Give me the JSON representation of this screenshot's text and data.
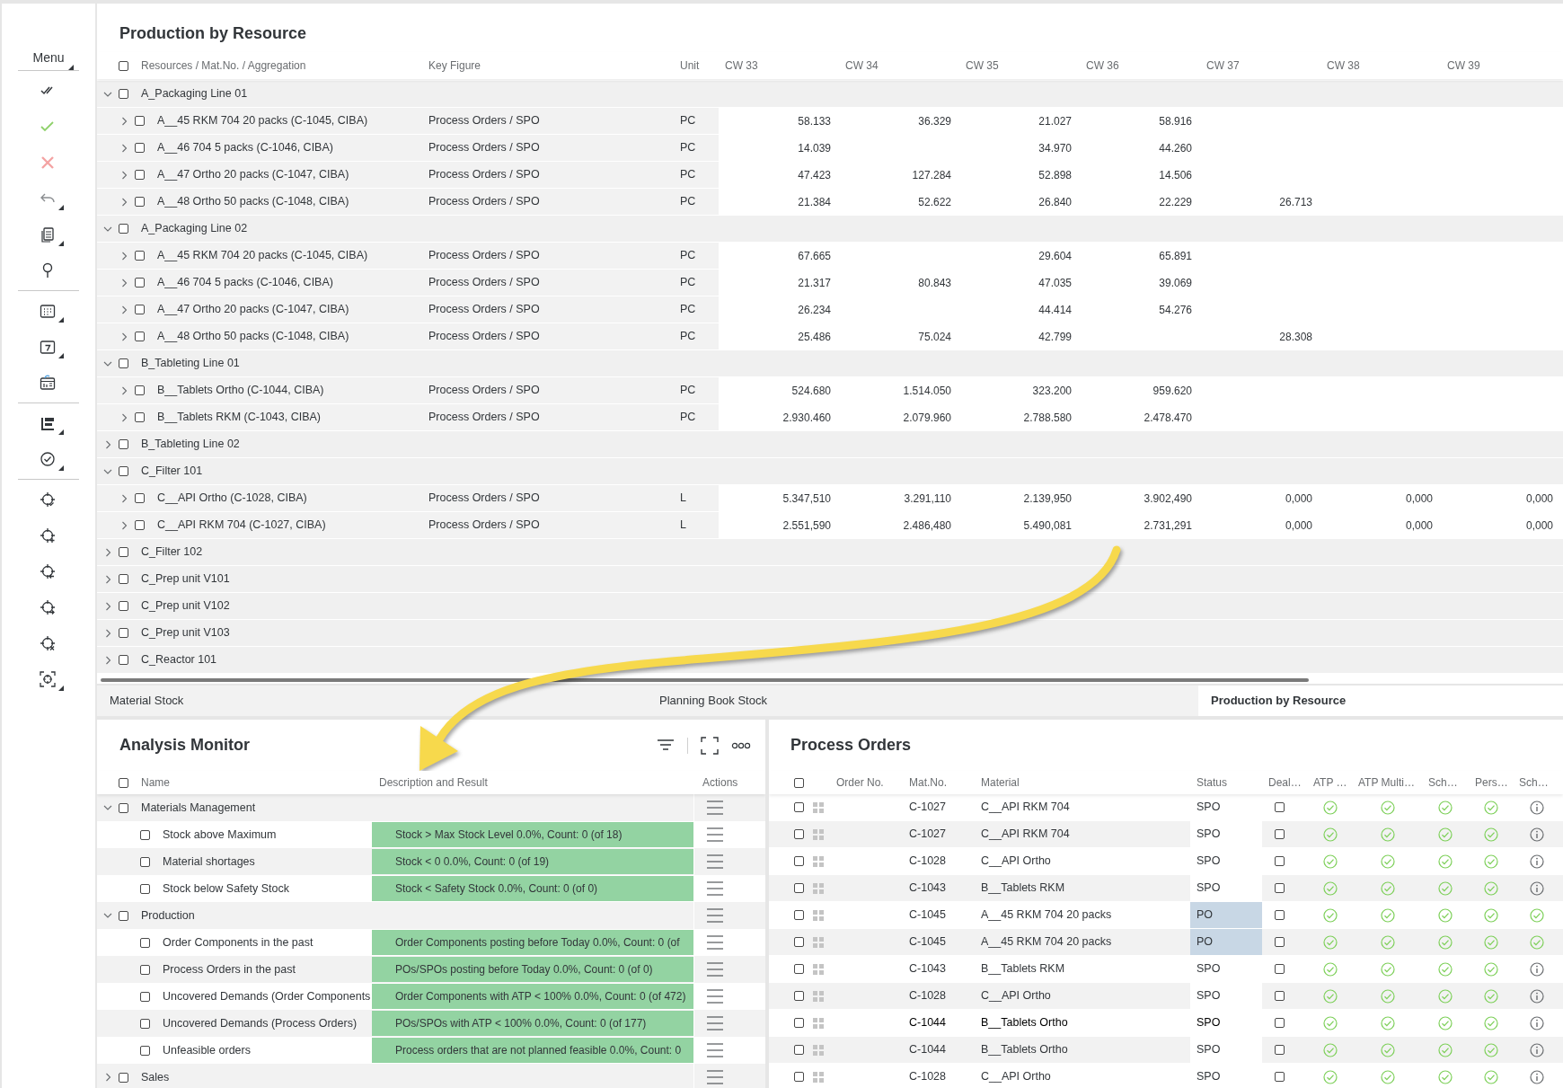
{
  "sidebar": {
    "menu_label": "Menu"
  },
  "production_by_resource": {
    "title": "Production by Resource",
    "checked": false,
    "columns": [
      "Resources / Mat.No. / Aggregation",
      "Key Figure",
      "Unit",
      "CW 33",
      "CW 34",
      "CW 35",
      "CW 36",
      "CW 37",
      "CW 38",
      "CW 39"
    ],
    "rows": [
      {
        "label": "A_Packaging Line 01",
        "expanded": true,
        "checked": false,
        "children": [
          {
            "label": "A__45 RKM 704 20 packs (C-1045, CIBA)",
            "key_figure": "Process Orders / SPO",
            "unit": "PC",
            "expanded": false,
            "checked": false,
            "values": [
              "58.133",
              "36.329",
              "21.027",
              "58.916"
            ]
          },
          {
            "label": "A__46 704 5 packs (C-1046, CIBA)",
            "key_figure": "Process Orders / SPO",
            "unit": "PC",
            "expanded": false,
            "checked": false,
            "values": [
              "14.039",
              {
                "kind": "empty"
              },
              "34.970",
              "44.260"
            ]
          },
          {
            "label": "A__47 Ortho 20 packs (C-1047, CIBA)",
            "key_figure": "Process Orders / SPO",
            "unit": "PC",
            "expanded": false,
            "checked": false,
            "values": [
              "47.423",
              "127.284",
              "52.898",
              "14.506"
            ]
          },
          {
            "label": "A__48 Ortho 50 packs (C-1048, CIBA)",
            "key_figure": "Process Orders / SPO",
            "unit": "PC",
            "expanded": false,
            "checked": false,
            "values": [
              "21.384",
              "52.622",
              "26.840",
              "22.229",
              "26.713"
            ]
          }
        ]
      },
      {
        "label": "A_Packaging Line 02",
        "expanded": true,
        "checked": false,
        "children": [
          {
            "label": "A__45 RKM 704 20 packs (C-1045, CIBA)",
            "key_figure": "Process Orders / SPO",
            "unit": "PC",
            "expanded": false,
            "checked": false,
            "values": [
              "67.665",
              {
                "kind": "empty"
              },
              "29.604",
              "65.891"
            ]
          },
          {
            "label": "A__46 704 5 packs (C-1046, CIBA)",
            "key_figure": "Process Orders / SPO",
            "unit": "PC",
            "expanded": false,
            "checked": false,
            "values": [
              "21.317",
              "80.843",
              "47.035",
              "39.069"
            ]
          },
          {
            "label": "A__47 Ortho 20 packs (C-1047, CIBA)",
            "key_figure": "Process Orders / SPO",
            "unit": "PC",
            "expanded": false,
            "checked": false,
            "values": [
              "26.234",
              {
                "kind": "empty"
              },
              "44.414",
              "54.276"
            ]
          },
          {
            "label": "A__48 Ortho 50 packs (C-1048, CIBA)",
            "key_figure": "Process Orders / SPO",
            "unit": "PC",
            "expanded": false,
            "checked": false,
            "values": [
              "25.486",
              "75.024",
              "42.799",
              {
                "kind": "empty"
              },
              "28.308"
            ]
          }
        ]
      },
      {
        "label": "B_Tableting Line 01",
        "expanded": true,
        "checked": false,
        "children": [
          {
            "label": "B__Tablets Ortho (C-1044, CIBA)",
            "key_figure": "Process Orders / SPO",
            "unit": "PC",
            "expanded": false,
            "checked": false,
            "values": [
              "524.680",
              "1.514.050",
              "323.200",
              "959.620"
            ]
          },
          {
            "label": "B__Tablets RKM (C-1043, CIBA)",
            "key_figure": "Process Orders / SPO",
            "unit": "PC",
            "expanded": false,
            "checked": false,
            "values": [
              "2.930.460",
              "2.079.960",
              "2.788.580",
              "2.478.470"
            ]
          }
        ]
      },
      {
        "label": "B_Tableting Line 02",
        "expanded": false,
        "checked": false
      },
      {
        "label": "C_Filter 101",
        "expanded": true,
        "checked": false,
        "children": [
          {
            "label": "C__API Ortho (C-1028, CIBA)",
            "key_figure": "Process Orders / SPO",
            "unit": "L",
            "expanded": false,
            "checked": false,
            "values": [
              "5.347,510",
              "3.291,110",
              "2.139,950",
              "3.902,490",
              "0,000",
              "0,000",
              "0,000"
            ]
          },
          {
            "label": "C__API RKM 704 (C-1027, CIBA)",
            "key_figure": "Process Orders / SPO",
            "unit": "L",
            "expanded": false,
            "checked": false,
            "values": [
              "2.551,590",
              "2.486,480",
              "5.490,081",
              "2.731,291",
              "0,000",
              "0,000",
              "0,000"
            ]
          }
        ]
      },
      {
        "label": "C_Filter 102",
        "expanded": false,
        "checked": false
      },
      {
        "label": "C_Prep unit V101",
        "expanded": false,
        "checked": false
      },
      {
        "label": "C_Prep unit V102",
        "expanded": false,
        "checked": false
      },
      {
        "label": "C_Prep unit V103",
        "expanded": false,
        "checked": false
      },
      {
        "label": "C_Reactor 101",
        "expanded": false,
        "checked": false
      }
    ]
  },
  "tabs": [
    {
      "label": "Material Stock",
      "selected": false
    },
    {
      "label": "Planning Book Stock",
      "selected": false
    },
    {
      "label": "Production by Resource",
      "selected": true
    }
  ],
  "analysis_monitor": {
    "title": "Analysis Monitor",
    "checked": false,
    "columns": [
      "Name",
      "Description and Result",
      "Actions"
    ],
    "rows": [
      {
        "name": "Materials Management",
        "expanded": true,
        "checked": false,
        "children": [
          {
            "name": "Stock above Maximum",
            "result": "Stock > Max Stock Level 0.0%, Count: 0 (of 18)",
            "passed": true,
            "checked": false
          },
          {
            "name": "Material shortages",
            "result": "Stock < 0 0.0%, Count: 0 (of 19)",
            "passed": true,
            "checked": false
          },
          {
            "name": "Stock below Safety Stock",
            "result": "Stock < Safety Stock 0.0%, Count: 0 (of 0)",
            "passed": true,
            "checked": false
          }
        ]
      },
      {
        "name": "Production",
        "expanded": true,
        "checked": false,
        "children": [
          {
            "name": "Order Components in the past",
            "result": "Order Components posting before Today 0.0%, Count: 0 (of",
            "passed": true,
            "checked": false
          },
          {
            "name": "Process Orders in the past",
            "result": "POs/SPOs posting before Today 0.0%, Count: 0 (of 0)",
            "passed": true,
            "checked": false
          },
          {
            "name": "Uncovered Demands (Order Components",
            "result": "Order Components with ATP < 100% 0.0%, Count: 0 (of 472)",
            "passed": true,
            "checked": false
          },
          {
            "name": "Uncovered Demands (Process Orders)",
            "result": "POs/SPOs with ATP < 100% 0.0%, Count: 0 (of 177)",
            "passed": true,
            "checked": false
          },
          {
            "name": "Unfeasible orders",
            "result": "Process orders that are not planned feasible 0.0%, Count: 0",
            "passed": true,
            "checked": false
          }
        ]
      },
      {
        "name": "Sales",
        "expanded": false,
        "checked": false
      }
    ]
  },
  "process_orders": {
    "title": "Process Orders",
    "checked": false,
    "columns": [
      "Order No.",
      "Mat.No.",
      "Material",
      "Status",
      "Deal…",
      "ATP …",
      "ATP Multi…",
      "Sch…",
      "Pers…",
      "Sch…"
    ],
    "rows": [
      {
        "mat_no": "C-1027",
        "material": "C__API RKM 704",
        "status": "SPO",
        "status_highlighted": false,
        "emphasized": false,
        "checked": false,
        "deal_checked": false,
        "indicators": [
          {
            "kind": "check"
          },
          {
            "kind": "check"
          },
          {
            "kind": "check"
          },
          {
            "kind": "check"
          },
          {
            "kind": "info"
          }
        ]
      },
      {
        "mat_no": "C-1027",
        "material": "C__API RKM 704",
        "status": "SPO",
        "status_highlighted": false,
        "emphasized": false,
        "checked": false,
        "deal_checked": false,
        "indicators": [
          {
            "kind": "check"
          },
          {
            "kind": "check"
          },
          {
            "kind": "check"
          },
          {
            "kind": "check"
          },
          {
            "kind": "info"
          }
        ]
      },
      {
        "mat_no": "C-1028",
        "material": "C__API Ortho",
        "status": "SPO",
        "status_highlighted": false,
        "emphasized": false,
        "checked": false,
        "deal_checked": false,
        "indicators": [
          {
            "kind": "check"
          },
          {
            "kind": "check"
          },
          {
            "kind": "check"
          },
          {
            "kind": "check"
          },
          {
            "kind": "info"
          }
        ]
      },
      {
        "mat_no": "C-1043",
        "material": "B__Tablets RKM",
        "status": "SPO",
        "status_highlighted": false,
        "emphasized": false,
        "checked": false,
        "deal_checked": false,
        "indicators": [
          {
            "kind": "check"
          },
          {
            "kind": "check"
          },
          {
            "kind": "check"
          },
          {
            "kind": "check"
          },
          {
            "kind": "info"
          }
        ]
      },
      {
        "mat_no": "C-1045",
        "material": "A__45 RKM 704 20 packs",
        "status": "PO",
        "status_highlighted": true,
        "emphasized": false,
        "checked": false,
        "deal_checked": false,
        "indicators": [
          {
            "kind": "check"
          },
          {
            "kind": "check"
          },
          {
            "kind": "check"
          },
          {
            "kind": "check"
          },
          {
            "kind": "check"
          }
        ]
      },
      {
        "mat_no": "C-1045",
        "material": "A__45 RKM 704 20 packs",
        "status": "PO",
        "status_highlighted": true,
        "emphasized": false,
        "checked": false,
        "deal_checked": false,
        "indicators": [
          {
            "kind": "check"
          },
          {
            "kind": "check"
          },
          {
            "kind": "check"
          },
          {
            "kind": "check"
          },
          {
            "kind": "check"
          }
        ]
      },
      {
        "mat_no": "C-1043",
        "material": "B__Tablets RKM",
        "status": "SPO",
        "status_highlighted": false,
        "emphasized": false,
        "checked": false,
        "deal_checked": false,
        "indicators": [
          {
            "kind": "check"
          },
          {
            "kind": "check"
          },
          {
            "kind": "check"
          },
          {
            "kind": "check"
          },
          {
            "kind": "info"
          }
        ]
      },
      {
        "mat_no": "C-1028",
        "material": "C__API Ortho",
        "status": "SPO",
        "status_highlighted": false,
        "emphasized": false,
        "checked": false,
        "deal_checked": false,
        "indicators": [
          {
            "kind": "check"
          },
          {
            "kind": "check"
          },
          {
            "kind": "check"
          },
          {
            "kind": "check"
          },
          {
            "kind": "info"
          }
        ]
      },
      {
        "mat_no": "C-1044",
        "material": "B__Tablets Ortho",
        "status": "SPO",
        "status_highlighted": false,
        "emphasized": true,
        "checked": false,
        "deal_checked": false,
        "indicators": [
          {
            "kind": "check"
          },
          {
            "kind": "check"
          },
          {
            "kind": "check"
          },
          {
            "kind": "check"
          },
          {
            "kind": "info"
          }
        ]
      },
      {
        "mat_no": "C-1044",
        "material": "B__Tablets Ortho",
        "status": "SPO",
        "status_highlighted": false,
        "emphasized": false,
        "checked": false,
        "deal_checked": false,
        "indicators": [
          {
            "kind": "check"
          },
          {
            "kind": "check"
          },
          {
            "kind": "check"
          },
          {
            "kind": "check"
          },
          {
            "kind": "info"
          }
        ]
      },
      {
        "mat_no": "C-1028",
        "material": "C__API Ortho",
        "status": "SPO",
        "status_highlighted": false,
        "emphasized": false,
        "checked": false,
        "deal_checked": false,
        "indicators": [
          {
            "kind": "check"
          },
          {
            "kind": "check"
          },
          {
            "kind": "check"
          },
          {
            "kind": "check"
          },
          {
            "kind": "info"
          }
        ]
      }
    ]
  }
}
